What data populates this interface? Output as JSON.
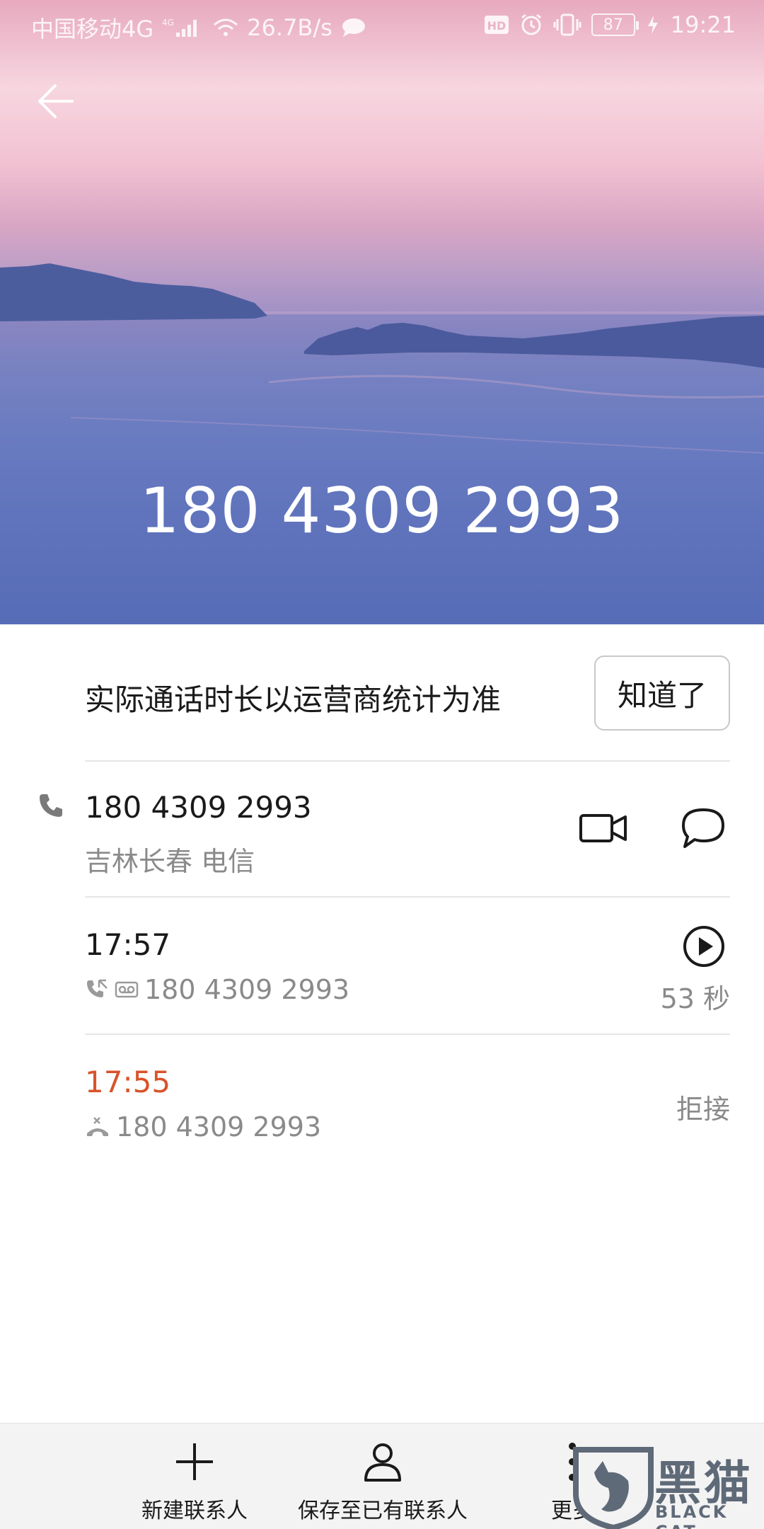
{
  "status_bar": {
    "carrier": "中国移动4G",
    "speed": "26.7B/s",
    "battery": "87",
    "time": "19:21"
  },
  "header": {
    "number": "180 4309 2993"
  },
  "notice": {
    "text": "实际通话时长以运营商统计为准",
    "button": "知道了"
  },
  "contact": {
    "number": "180 4309 2993",
    "location": "吉林长春 电信"
  },
  "records": [
    {
      "time": "17:57",
      "number": "180 4309 2993",
      "duration": "53 秒",
      "time_color": "#1a1a1a"
    },
    {
      "time": "17:55",
      "number": "180 4309 2993",
      "status": "拒接",
      "time_color": "#d9532a"
    }
  ],
  "toolbar": {
    "new_contact": "新建联系人",
    "save_existing": "保存至已有联系人",
    "more": "更多"
  },
  "watermark": {
    "title": "黑猫",
    "subtitle": "BLACK CAT"
  }
}
